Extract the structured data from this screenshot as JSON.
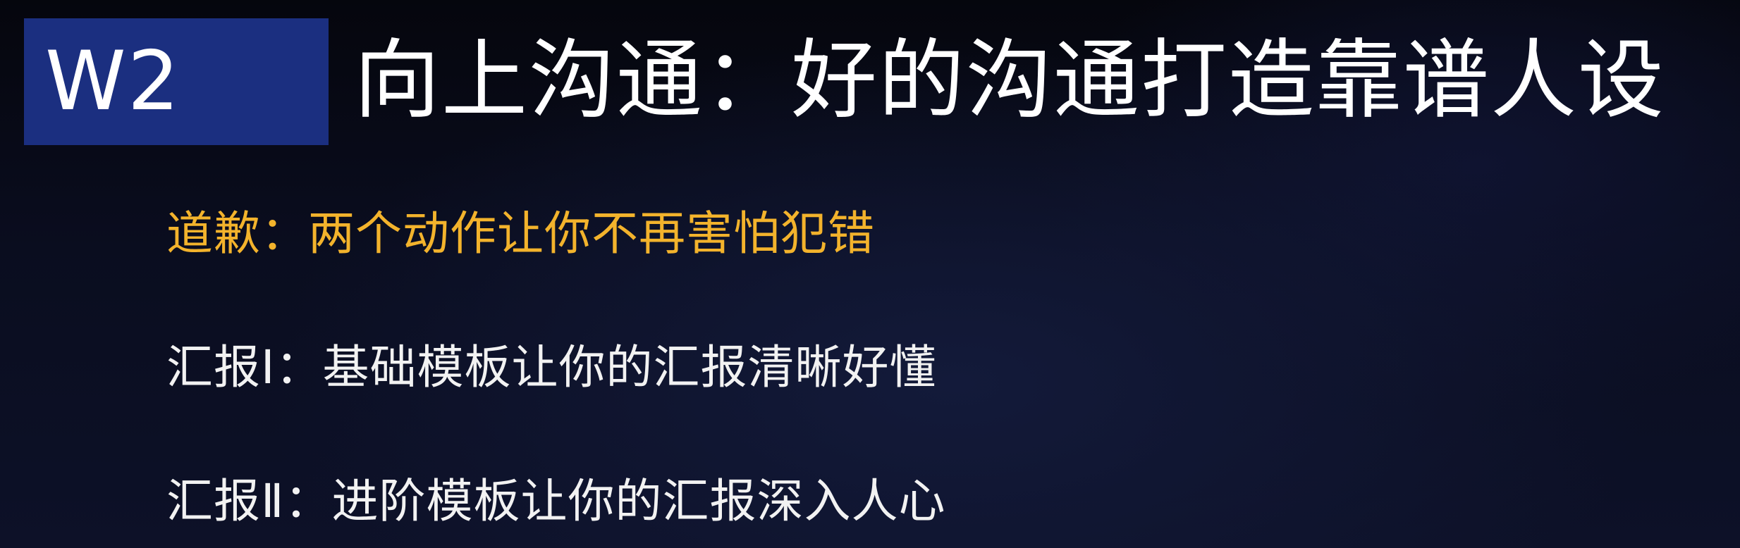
{
  "badge": {
    "label": "W2"
  },
  "title": "向上沟通：好的沟通打造靠谱人设",
  "colors": {
    "badge_bg": "#1b2f80",
    "highlight_text": "#f3b32c",
    "normal_text": "#f2f2f2",
    "background": "#0a0d1f"
  },
  "agenda": [
    {
      "text": "道歉：两个动作让你不再害怕犯错",
      "highlighted": true
    },
    {
      "text": "汇报Ⅰ：基础模板让你的汇报清晰好懂",
      "highlighted": false
    },
    {
      "text": "汇报Ⅱ：进阶模板让你的汇报深入人心",
      "highlighted": false
    }
  ]
}
